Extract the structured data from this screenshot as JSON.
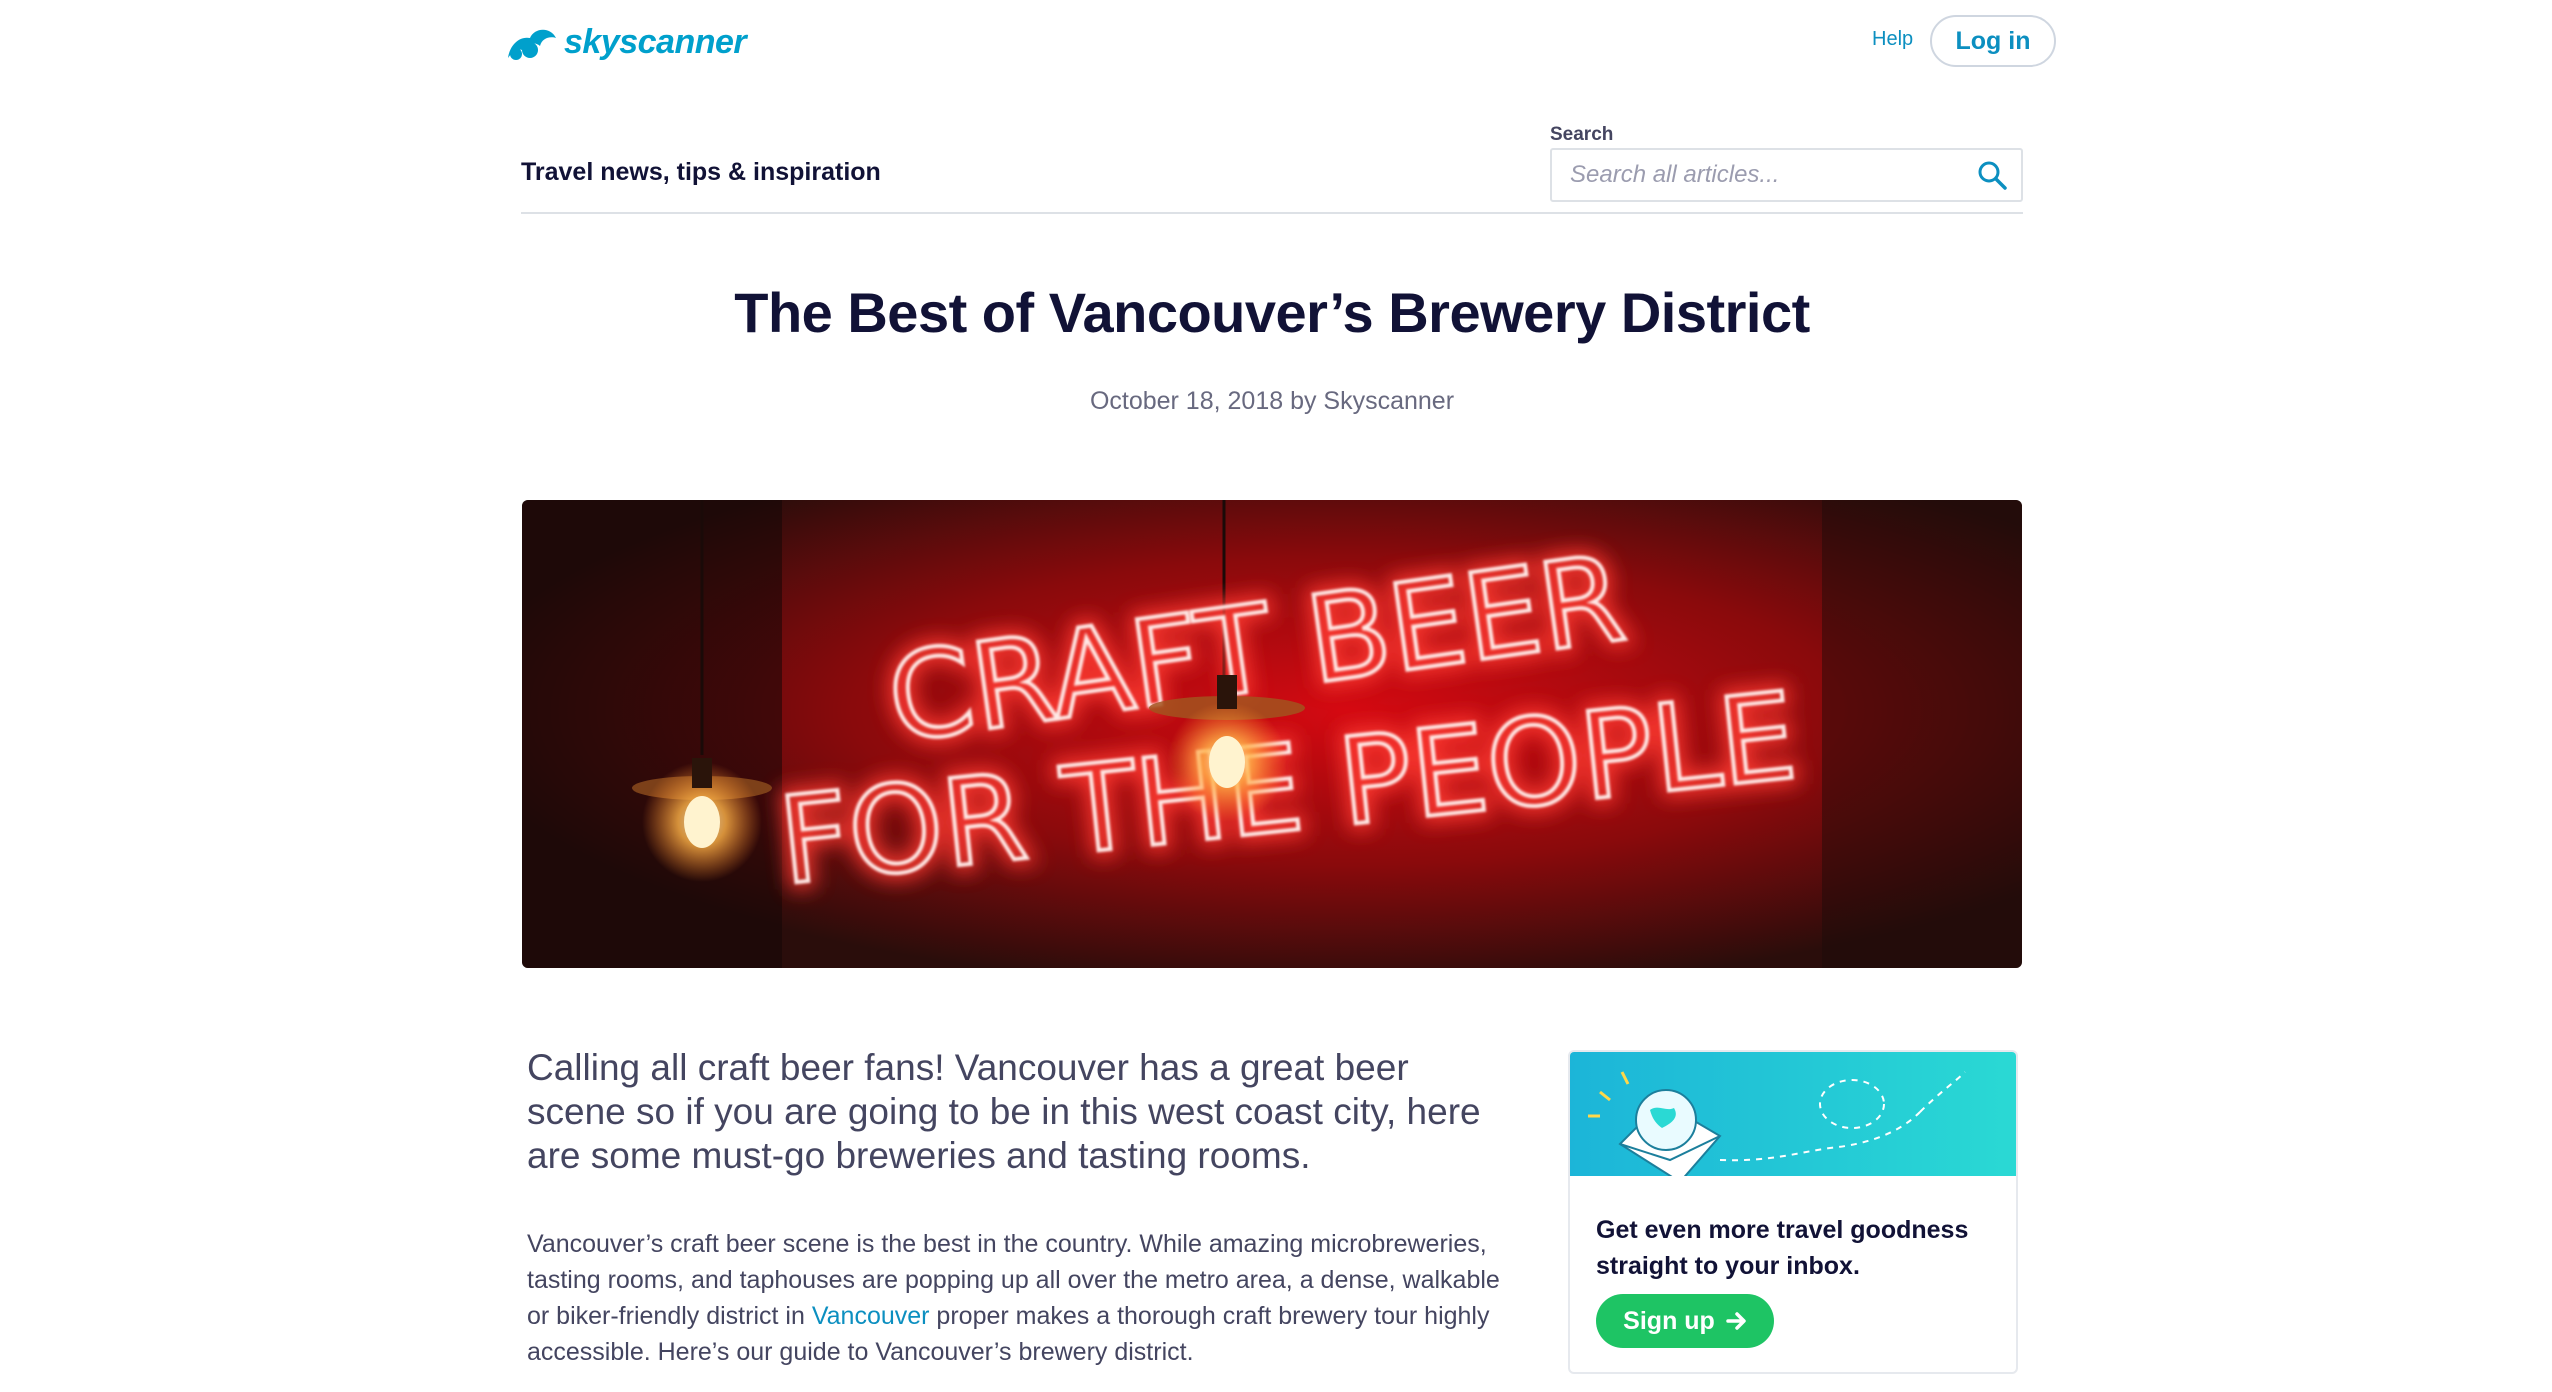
{
  "header": {
    "logo_text": "skyscanner",
    "help_label": "Help",
    "login_label": "Log in"
  },
  "section": {
    "title": "Travel news, tips & inspiration",
    "search_label": "Search",
    "search_placeholder": "Search all articles..."
  },
  "article": {
    "title": "The Best of Vancouver’s Brewery District",
    "byline": "October 18, 2018 by Skyscanner",
    "hero_sign_line1": "CRAFT BEER",
    "hero_sign_line2": "FOR THE PEOPLE",
    "lead": "Calling all craft beer fans! Vancouver has a great beer scene so if you are going to be in this west coast city, here are some must-go breweries and tasting rooms.",
    "para_before_link": "Vancouver’s craft beer scene is the best in the country. While amazing microbreweries, tasting rooms, and taphouses are popping up all over the metro area, a dense, walkable or biker-friendly district in ",
    "para_link": "Vancouver",
    "para_after_link": " proper makes a thorough craft brewery tour highly accessible. Here’s our guide to Vancouver’s brewery district."
  },
  "newsletter": {
    "heading": "Get even more travel goodness straight to your inbox.",
    "signup_label": "Sign up",
    "signup_icon": "arrow-right-icon"
  },
  "colors": {
    "brand": "#00a0cc",
    "link": "#0c8fc0",
    "signup": "#1ec464",
    "banner_start": "#1cb5d8",
    "banner_end": "#2ad9d4",
    "neon": "#ff2a2a"
  }
}
